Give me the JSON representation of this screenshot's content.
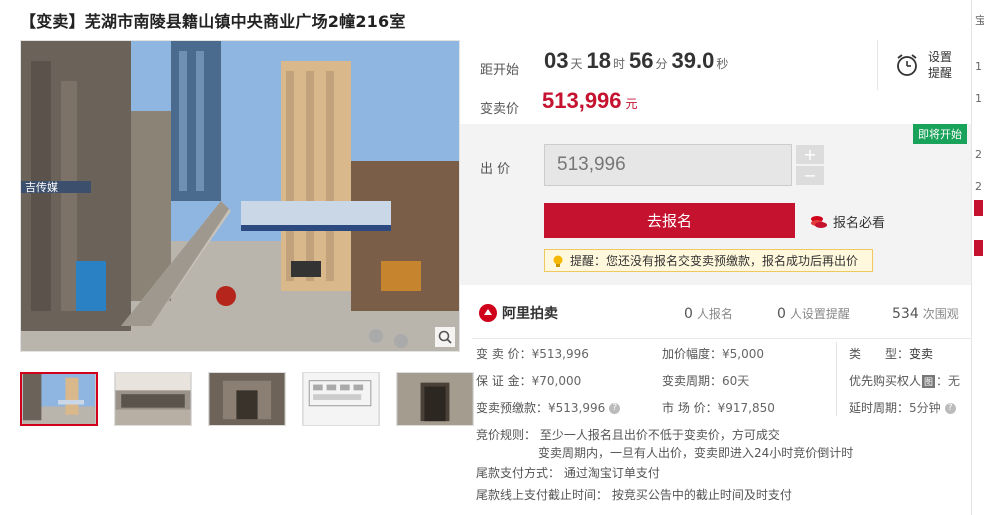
{
  "title": "【变卖】芜湖市南陵县籍山镇中央商业广场2幢216室",
  "countdown": {
    "label": "距开始",
    "days": "03",
    "days_unit": "天",
    "hours": "18",
    "hours_unit": "时",
    "minutes": "56",
    "minutes_unit": "分",
    "seconds": "39.0",
    "seconds_unit": "秒"
  },
  "reminder": {
    "label": "设置提醒"
  },
  "price": {
    "label": "变卖价",
    "value": "513,996",
    "unit": "元"
  },
  "bid": {
    "label": "出 价",
    "input_value": "513,996",
    "plus": "+",
    "minus": "−",
    "badge": "即将开始",
    "signup_button": "去报名",
    "must_read": "报名必看",
    "tip": "提醒：您还没有报名交变卖预缴款，报名成功后再出价"
  },
  "stats": {
    "logo_text": "阿里拍卖",
    "signups_num": "0",
    "signups_label": "人报名",
    "reminders_num": "0",
    "reminders_label": "人设置提醒",
    "views_num": "534",
    "views_label": "次围观"
  },
  "info": {
    "sale_price_label": "变 卖 价：",
    "sale_price": "¥513,996",
    "deposit_label": "保 证 金：",
    "deposit": "¥70,000",
    "prepay_label": "变卖预缴款：",
    "prepay": "¥513,996",
    "increment_label": "加价幅度：",
    "increment": "¥5,000",
    "cycle_label": "变卖周期：",
    "cycle": "60天",
    "market_label": "市 场 价：",
    "market": "¥917,850",
    "type_label": "类　　型：",
    "type": "变卖",
    "priority_label": "优先购买权人",
    "priority_tag": "图",
    "priority": "：无",
    "delay_label": "延时周期：",
    "delay": "5分钟"
  },
  "rules": {
    "line1": "竞价规则：  至少一人报名且出价不低于变卖价，方可成交",
    "line2": "变卖周期内，一旦有人出价，变卖即进入24小时竞价倒计时",
    "line3": "尾款支付方式：  通过淘宝订单支付",
    "line4": "尾款线上支付截止时间：  按竞买公告中的截止时间及时支付"
  },
  "right_strip": [
    "宝",
    "1",
    "1",
    "2",
    "2"
  ],
  "colors": {
    "accent": "#c4122f",
    "badge_green": "#19a35a"
  }
}
